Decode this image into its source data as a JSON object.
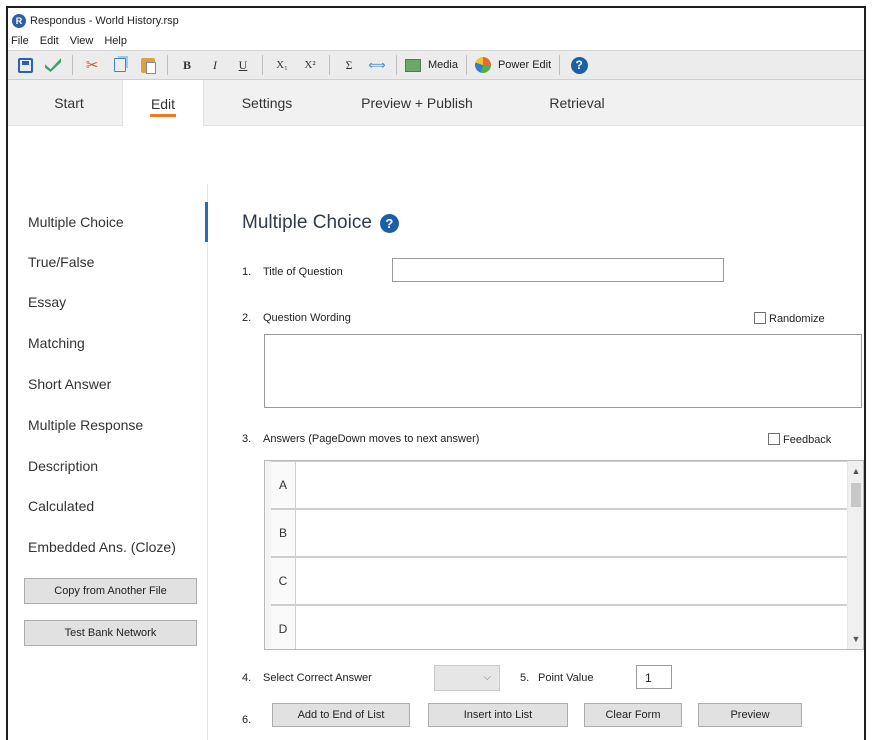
{
  "window": {
    "title": "Respondus - World History.rsp",
    "app_icon_letter": "R"
  },
  "menu": [
    "File",
    "Edit",
    "View",
    "Help"
  ],
  "toolbar": {
    "bold": "B",
    "italic": "I",
    "underline": "U",
    "subscript": "X₁",
    "superscript": "X²",
    "sigma": "Σ",
    "link": "⟺",
    "media_label": "Media",
    "power_edit_label": "Power Edit",
    "help": "?"
  },
  "tabs": [
    {
      "label": "Start",
      "active": false
    },
    {
      "label": "Edit",
      "active": true
    },
    {
      "label": "Settings",
      "active": false
    },
    {
      "label": "Preview + Publish",
      "active": false
    },
    {
      "label": "Retrieval",
      "active": false
    }
  ],
  "sidebar": {
    "items": [
      {
        "label": "Multiple Choice",
        "active": true
      },
      {
        "label": "True/False"
      },
      {
        "label": "Essay"
      },
      {
        "label": "Matching"
      },
      {
        "label": "Short Answer"
      },
      {
        "label": "Multiple Response"
      },
      {
        "label": "Description"
      },
      {
        "label": "Calculated"
      },
      {
        "label": "Embedded Ans. (Cloze)"
      }
    ],
    "copy_button": "Copy from Another File",
    "testbank_button": "Test Bank Network"
  },
  "main": {
    "title": "Multiple Choice",
    "help": "?",
    "step1": {
      "num": "1.",
      "label": "Title of Question",
      "value": ""
    },
    "step2": {
      "num": "2.",
      "label": "Question Wording",
      "randomize": "Randomize"
    },
    "step3": {
      "num": "3.",
      "label": "Answers  (PageDown moves to next answer)",
      "feedback": "Feedback"
    },
    "answers": [
      "A",
      "B",
      "C",
      "D"
    ],
    "step4": {
      "num": "4.",
      "label": "Select Correct Answer",
      "selected": ""
    },
    "step5": {
      "num": "5.",
      "label": "Point Value",
      "value": "1"
    },
    "step6": {
      "num": "6.",
      "add_to_end": "Add to End of List",
      "insert": "Insert into List",
      "clear": "Clear Form",
      "preview": "Preview"
    }
  },
  "colors": {
    "accent_tab": "#f07b1e",
    "active_indicator": "#2d6ab3",
    "help_blue": "#1d5fa6"
  }
}
